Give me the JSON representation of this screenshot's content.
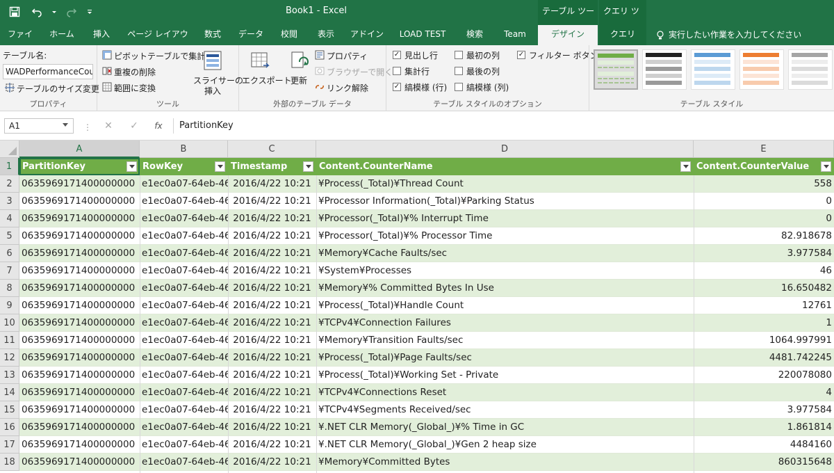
{
  "window": {
    "title": "Book1 - Excel",
    "context_table_tools": "テーブル ツール",
    "context_query_tools": "クエリ ツール"
  },
  "tabs": [
    {
      "label": "ファイル"
    },
    {
      "label": "ホーム"
    },
    {
      "label": "挿入"
    },
    {
      "label": "ページ レイアウト"
    },
    {
      "label": "数式"
    },
    {
      "label": "データ"
    },
    {
      "label": "校閲"
    },
    {
      "label": "表示"
    },
    {
      "label": "アドイン"
    },
    {
      "label": "LOAD TEST"
    },
    {
      "label": "検索"
    },
    {
      "label": "Team"
    },
    {
      "label": "デザイン"
    },
    {
      "label": "クエリ"
    }
  ],
  "tell_me": "実行したい作業を入力してください",
  "ribbon": {
    "properties": {
      "table_name_label": "テーブル名:",
      "table_name_value": "WADPerformanceCou",
      "resize_label": "テーブルのサイズ変更",
      "group_label": "プロパティ"
    },
    "tools": {
      "pivot_label": "ピボットテーブルで集計",
      "remove_dupes_label": "重複の削除",
      "convert_range_label": "範囲に変換",
      "slicer_label_1": "スライサーの",
      "slicer_label_2": "挿入",
      "group_label": "ツール"
    },
    "external": {
      "export_label": "エクスポート",
      "refresh_label": "更新",
      "properties_label": "プロパティ",
      "open_browser_label": "ブラウザーで開く",
      "unlink_label": "リンク解除",
      "group_label": "外部のテーブル データ"
    },
    "style_options": {
      "header_row": "見出し行",
      "total_row": "集計行",
      "banded_rows": "縞模様 (行)",
      "first_column": "最初の列",
      "last_column": "最後の列",
      "banded_columns": "縞模様 (列)",
      "filter_button": "フィルター ボタン",
      "header_row_checked": true,
      "total_row_checked": false,
      "banded_rows_checked": true,
      "first_column_checked": false,
      "last_column_checked": false,
      "banded_columns_checked": false,
      "filter_button_checked": true,
      "group_label": "テーブル スタイルのオプション"
    },
    "styles": {
      "group_label": "テーブル スタイル",
      "swatch_colors": [
        "#70ad47",
        "#222222",
        "#5b9bd5",
        "#ed7d31",
        "#a5a5a5"
      ]
    }
  },
  "formula_bar": {
    "name_box": "A1",
    "cancel_glyph": "✕",
    "enter_glyph": "✓",
    "fx_glyph": "fx",
    "formula": "PartitionKey"
  },
  "sheet": {
    "columns": [
      "A",
      "B",
      "C",
      "D",
      "E"
    ],
    "headers": [
      "PartitionKey",
      "RowKey",
      "Timestamp",
      "Content.CounterName",
      "Content.CounterValue"
    ],
    "rows": [
      [
        "0635969171400000000",
        "e1ec0a07-64eb-46",
        "2016/4/22 10:21",
        "¥Process(_Total)¥Thread Count",
        "558"
      ],
      [
        "0635969171400000000",
        "e1ec0a07-64eb-46",
        "2016/4/22 10:21",
        "¥Processor Information(_Total)¥Parking Status",
        "0"
      ],
      [
        "0635969171400000000",
        "e1ec0a07-64eb-46",
        "2016/4/22 10:21",
        "¥Processor(_Total)¥% Interrupt Time",
        "0"
      ],
      [
        "0635969171400000000",
        "e1ec0a07-64eb-46",
        "2016/4/22 10:21",
        "¥Processor(_Total)¥% Processor Time",
        "82.918678"
      ],
      [
        "0635969171400000000",
        "e1ec0a07-64eb-46",
        "2016/4/22 10:21",
        "¥Memory¥Cache Faults/sec",
        "3.977584"
      ],
      [
        "0635969171400000000",
        "e1ec0a07-64eb-46",
        "2016/4/22 10:21",
        "¥System¥Processes",
        "46"
      ],
      [
        "0635969171400000000",
        "e1ec0a07-64eb-46",
        "2016/4/22 10:21",
        "¥Memory¥% Committed Bytes In Use",
        "16.650482"
      ],
      [
        "0635969171400000000",
        "e1ec0a07-64eb-46",
        "2016/4/22 10:21",
        "¥Process(_Total)¥Handle Count",
        "12761"
      ],
      [
        "0635969171400000000",
        "e1ec0a07-64eb-46",
        "2016/4/22 10:21",
        "¥TCPv4¥Connection Failures",
        "1"
      ],
      [
        "0635969171400000000",
        "e1ec0a07-64eb-46",
        "2016/4/22 10:21",
        "¥Memory¥Transition Faults/sec",
        "1064.997991"
      ],
      [
        "0635969171400000000",
        "e1ec0a07-64eb-46",
        "2016/4/22 10:21",
        "¥Process(_Total)¥Page Faults/sec",
        "4481.742245"
      ],
      [
        "0635969171400000000",
        "e1ec0a07-64eb-46",
        "2016/4/22 10:21",
        "¥Process(_Total)¥Working Set - Private",
        "220078080"
      ],
      [
        "0635969171400000000",
        "e1ec0a07-64eb-46",
        "2016/4/22 10:21",
        "¥TCPv4¥Connections Reset",
        "4"
      ],
      [
        "0635969171400000000",
        "e1ec0a07-64eb-46",
        "2016/4/22 10:21",
        "¥TCPv4¥Segments Received/sec",
        "3.977584"
      ],
      [
        "0635969171400000000",
        "e1ec0a07-64eb-46",
        "2016/4/22 10:21",
        "¥.NET CLR Memory(_Global_)¥% Time in GC",
        "1.861814"
      ],
      [
        "0635969171400000000",
        "e1ec0a07-64eb-46",
        "2016/4/22 10:21",
        "¥.NET CLR Memory(_Global_)¥Gen 2 heap size",
        "4484160"
      ],
      [
        "0635969171400000000",
        "e1ec0a07-64eb-46",
        "2016/4/22 10:21",
        "¥Memory¥Committed Bytes",
        "860315648"
      ]
    ]
  }
}
